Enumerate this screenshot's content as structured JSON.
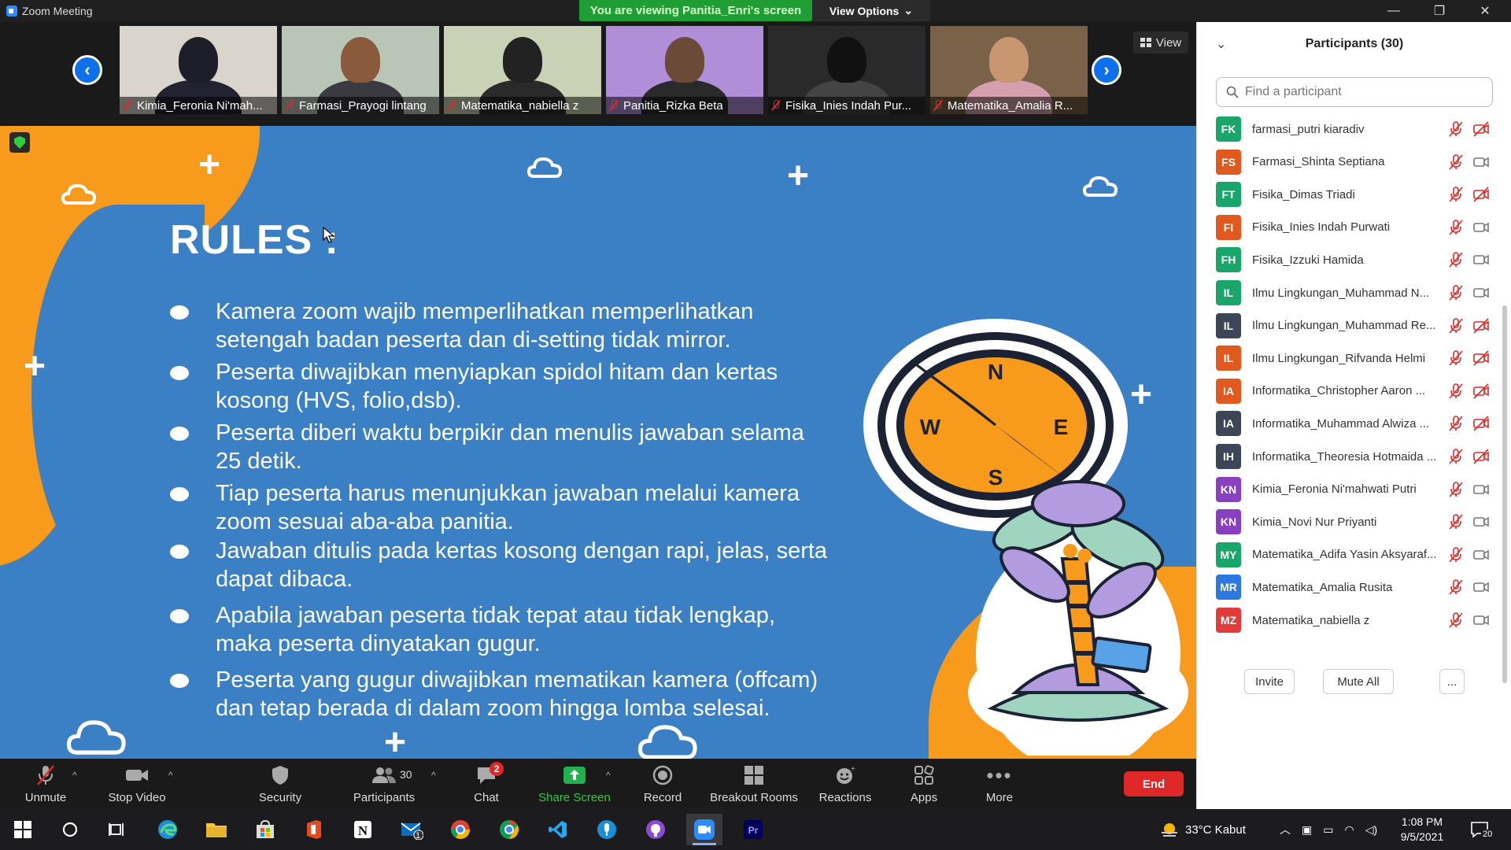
{
  "window": {
    "title": "Zoom Meeting",
    "viewing_banner": "You are viewing Panitia_Enri's screen",
    "view_options_label": "View Options"
  },
  "video_strip": {
    "view_label": "View",
    "tiles": [
      {
        "name": "Kimia_Feronia Ni'mah...",
        "bg": "#d9d4cc",
        "skin": "#1e1e2a",
        "shirt": "#222230"
      },
      {
        "name": "Farmasi_Prayogi lintang",
        "bg": "#b9c6b7",
        "skin": "#8a5a3c",
        "shirt": "#3a3a40"
      },
      {
        "name": "Matematika_nabiella z",
        "bg": "#c9d2b4",
        "skin": "#222",
        "shirt": "#2a2a2a"
      },
      {
        "name": "Panitia_Rizka Beta",
        "bg": "#b08ed8",
        "skin": "#6b4a38",
        "shirt": "#2a2a2a"
      },
      {
        "name": "Fisika_Inies Indah Pur...",
        "bg": "#2a2a2a",
        "skin": "#111",
        "shirt": "#444"
      },
      {
        "name": "Matematika_Amalia R...",
        "bg": "#7a6248",
        "skin": "#c89670",
        "shirt": "#d59fb0"
      }
    ]
  },
  "slide": {
    "title": "RULES :",
    "rules": [
      {
        "text": "Kamera zoom wajib memperlihatkan memperlihatkan setengah badan peserta dan di-setting tidak mirror."
      },
      {
        "text": "Peserta diwajibkan menyiapkan spidol hitam dan kertas kosong (HVS, folio,dsb)."
      },
      {
        "text": "Peserta diberi waktu berpikir dan menulis jawaban selama 25 detik."
      },
      {
        "text": "Tiap peserta harus menunjukkan jawaban melalui kamera zoom sesuai aba-aba panitia."
      },
      {
        "text": "Jawaban ditulis pada kertas kosong dengan rapi, jelas, serta dapat dibaca."
      },
      {
        "text": "Apabila jawaban peserta tidak tepat atau tidak lengkap, maka peserta dinyatakan gugur."
      },
      {
        "text": "Peserta yang gugur diwajibkan mematikan kamera (offcam) dan tetap berada di dalam zoom hingga lomba selesai."
      }
    ],
    "compass": {
      "n": "N",
      "s": "S",
      "e": "E",
      "w": "W"
    },
    "colors": {
      "background": "#3b7fc4",
      "accent": "#f89a1c"
    }
  },
  "participants": {
    "title": "Participants (30)",
    "search_placeholder": "Find a participant",
    "invite_label": "Invite",
    "mute_all_label": "Mute All",
    "more_label": "...",
    "list": [
      {
        "initials": "FK",
        "name": "farmasi_putri kiaradiv",
        "color": "#1aa56a",
        "cam_off": true
      },
      {
        "initials": "FS",
        "name": "Farmasi_Shinta Septiana",
        "color": "#e0591e",
        "cam_off": false
      },
      {
        "initials": "FT",
        "name": "Fisika_Dimas Triadi",
        "color": "#1aa56a",
        "cam_off": true
      },
      {
        "initials": "FI",
        "name": "Fisika_Inies Indah Purwati",
        "color": "#e0591e",
        "cam_off": false
      },
      {
        "initials": "FH",
        "name": "Fisika_Izzuki Hamida",
        "color": "#1aa56a",
        "cam_off": false
      },
      {
        "initials": "IL",
        "name": "Ilmu Lingkungan_Muhammad N...",
        "color": "#1aa56a",
        "cam_off": false
      },
      {
        "initials": "IL",
        "name": "Ilmu Lingkungan_Muhammad Re...",
        "color": "#3d4657",
        "cam_off": true
      },
      {
        "initials": "IL",
        "name": "Ilmu Lingkungan_Rifvanda Helmi",
        "color": "#e0591e",
        "cam_off": true
      },
      {
        "initials": "IA",
        "name": "Informatika_Christopher Aaron ...",
        "color": "#e0591e",
        "cam_off": true
      },
      {
        "initials": "IA",
        "name": "Informatika_Muhammad Alwiza ...",
        "color": "#3d4657",
        "cam_off": true
      },
      {
        "initials": "IH",
        "name": "Informatika_Theoresia Hotmaida ...",
        "color": "#3d4657",
        "cam_off": true
      },
      {
        "initials": "KN",
        "name": "Kimia_Feronia Ni'mahwati Putri",
        "color": "#8a3ec0",
        "cam_off": false
      },
      {
        "initials": "KN",
        "name": "Kimia_Novi Nur Priyanti",
        "color": "#8a3ec0",
        "cam_off": false
      },
      {
        "initials": "MY",
        "name": "Matematika_Adifa Yasin Aksyaraf...",
        "color": "#1aa56a",
        "cam_off": false
      },
      {
        "initials": "MR",
        "name": "Matematika_Amalia Rusita",
        "color": "#2d78e0",
        "cam_off": false
      },
      {
        "initials": "MZ",
        "name": "Matematika_nabiella z",
        "color": "#e03c3c",
        "cam_off": false
      }
    ]
  },
  "toolbar": {
    "unmute": "Unmute",
    "stop_video": "Stop Video",
    "security": "Security",
    "participants": "Participants",
    "participants_count": "30",
    "chat": "Chat",
    "chat_badge": "2",
    "share_screen": "Share Screen",
    "record": "Record",
    "breakout_rooms": "Breakout Rooms",
    "reactions": "Reactions",
    "apps": "Apps",
    "more": "More",
    "end": "End"
  },
  "taskbar": {
    "weather": "33°C  Kabut",
    "time": "1:08 PM",
    "date": "9/5/2021",
    "notification_count": "20",
    "mail_badge": "1"
  }
}
